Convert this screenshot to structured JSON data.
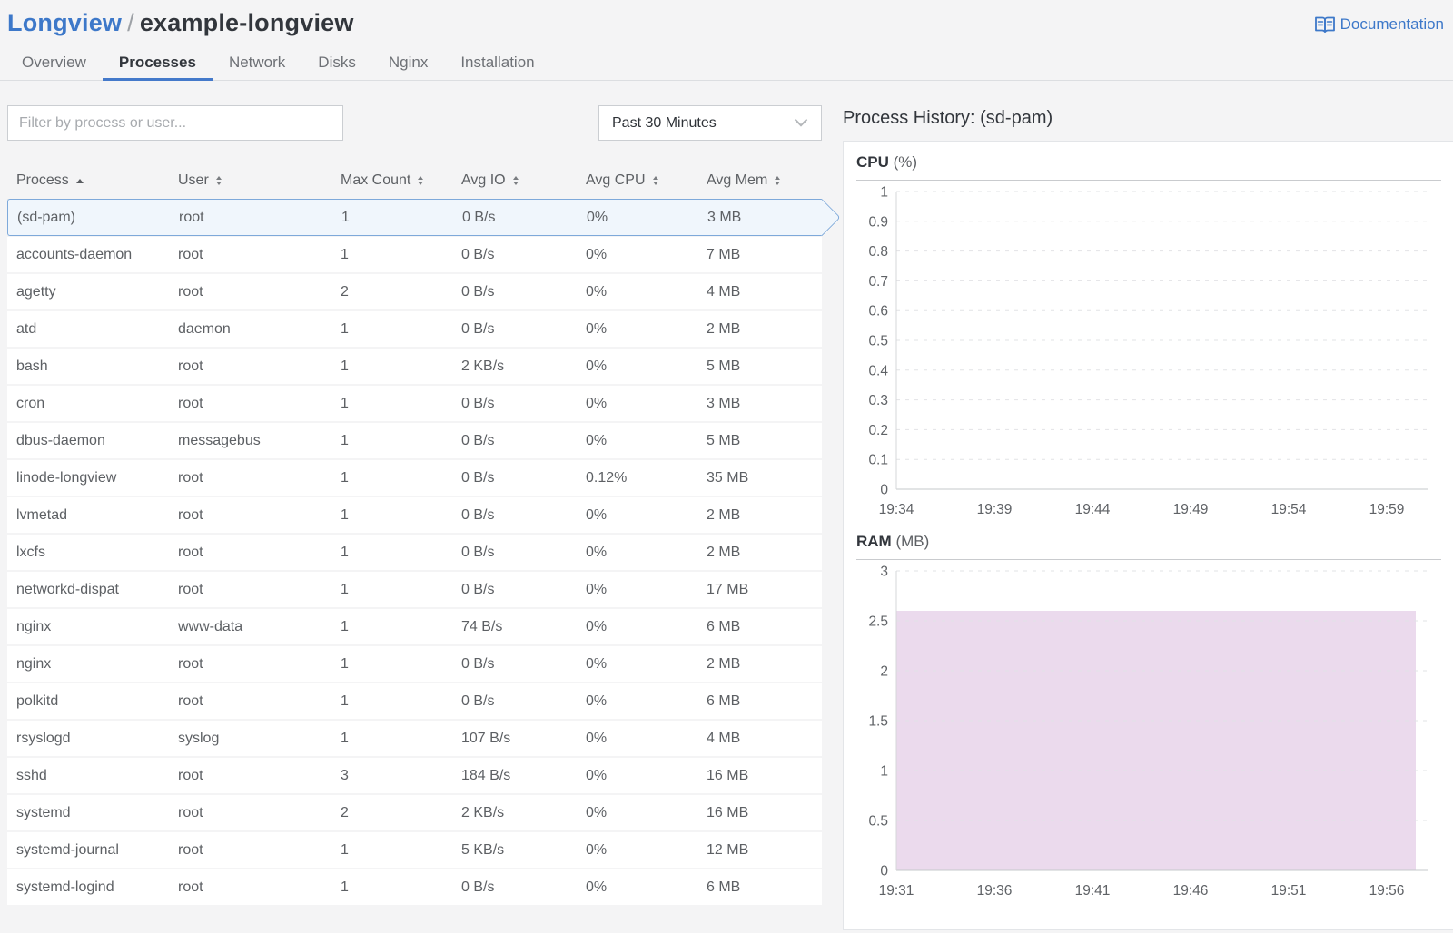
{
  "header": {
    "app": "Longview",
    "separator": "/",
    "instance": "example-longview",
    "doc_label": "Documentation"
  },
  "tabs": [
    {
      "label": "Overview",
      "active": false
    },
    {
      "label": "Processes",
      "active": true
    },
    {
      "label": "Network",
      "active": false
    },
    {
      "label": "Disks",
      "active": false
    },
    {
      "label": "Nginx",
      "active": false
    },
    {
      "label": "Installation",
      "active": false
    }
  ],
  "controls": {
    "filter_placeholder": "Filter by process or user...",
    "time_range": "Past 30 Minutes"
  },
  "table": {
    "columns": [
      {
        "label": "Process",
        "sort": "asc"
      },
      {
        "label": "User",
        "sort": "both"
      },
      {
        "label": "Max Count",
        "sort": "both"
      },
      {
        "label": "Avg IO",
        "sort": "both"
      },
      {
        "label": "Avg CPU",
        "sort": "both"
      },
      {
        "label": "Avg Mem",
        "sort": "both"
      }
    ],
    "rows": [
      {
        "process": "(sd-pam)",
        "user": "root",
        "max_count": "1",
        "avg_io": "0 B/s",
        "avg_cpu": "0%",
        "avg_mem": "3 MB",
        "selected": true
      },
      {
        "process": "accounts-daemon",
        "user": "root",
        "max_count": "1",
        "avg_io": "0 B/s",
        "avg_cpu": "0%",
        "avg_mem": "7 MB",
        "selected": false
      },
      {
        "process": "agetty",
        "user": "root",
        "max_count": "2",
        "avg_io": "0 B/s",
        "avg_cpu": "0%",
        "avg_mem": "4 MB",
        "selected": false
      },
      {
        "process": "atd",
        "user": "daemon",
        "max_count": "1",
        "avg_io": "0 B/s",
        "avg_cpu": "0%",
        "avg_mem": "2 MB",
        "selected": false
      },
      {
        "process": "bash",
        "user": "root",
        "max_count": "1",
        "avg_io": "2 KB/s",
        "avg_cpu": "0%",
        "avg_mem": "5 MB",
        "selected": false
      },
      {
        "process": "cron",
        "user": "root",
        "max_count": "1",
        "avg_io": "0 B/s",
        "avg_cpu": "0%",
        "avg_mem": "3 MB",
        "selected": false
      },
      {
        "process": "dbus-daemon",
        "user": "messagebus",
        "max_count": "1",
        "avg_io": "0 B/s",
        "avg_cpu": "0%",
        "avg_mem": "5 MB",
        "selected": false
      },
      {
        "process": "linode-longview",
        "user": "root",
        "max_count": "1",
        "avg_io": "0 B/s",
        "avg_cpu": "0.12%",
        "avg_mem": "35 MB",
        "selected": false
      },
      {
        "process": "lvmetad",
        "user": "root",
        "max_count": "1",
        "avg_io": "0 B/s",
        "avg_cpu": "0%",
        "avg_mem": "2 MB",
        "selected": false
      },
      {
        "process": "lxcfs",
        "user": "root",
        "max_count": "1",
        "avg_io": "0 B/s",
        "avg_cpu": "0%",
        "avg_mem": "2 MB",
        "selected": false
      },
      {
        "process": "networkd-dispat",
        "user": "root",
        "max_count": "1",
        "avg_io": "0 B/s",
        "avg_cpu": "0%",
        "avg_mem": "17 MB",
        "selected": false
      },
      {
        "process": "nginx",
        "user": "www-data",
        "max_count": "1",
        "avg_io": "74 B/s",
        "avg_cpu": "0%",
        "avg_mem": "6 MB",
        "selected": false
      },
      {
        "process": "nginx",
        "user": "root",
        "max_count": "1",
        "avg_io": "0 B/s",
        "avg_cpu": "0%",
        "avg_mem": "2 MB",
        "selected": false
      },
      {
        "process": "polkitd",
        "user": "root",
        "max_count": "1",
        "avg_io": "0 B/s",
        "avg_cpu": "0%",
        "avg_mem": "6 MB",
        "selected": false
      },
      {
        "process": "rsyslogd",
        "user": "syslog",
        "max_count": "1",
        "avg_io": "107 B/s",
        "avg_cpu": "0%",
        "avg_mem": "4 MB",
        "selected": false
      },
      {
        "process": "sshd",
        "user": "root",
        "max_count": "3",
        "avg_io": "184 B/s",
        "avg_cpu": "0%",
        "avg_mem": "16 MB",
        "selected": false
      },
      {
        "process": "systemd",
        "user": "root",
        "max_count": "2",
        "avg_io": "2 KB/s",
        "avg_cpu": "0%",
        "avg_mem": "16 MB",
        "selected": false
      },
      {
        "process": "systemd-journal",
        "user": "root",
        "max_count": "1",
        "avg_io": "5 KB/s",
        "avg_cpu": "0%",
        "avg_mem": "12 MB",
        "selected": false
      },
      {
        "process": "systemd-logind",
        "user": "root",
        "max_count": "1",
        "avg_io": "0 B/s",
        "avg_cpu": "0%",
        "avg_mem": "6 MB",
        "selected": false
      }
    ]
  },
  "history": {
    "title": "Process History: (sd-pam)"
  },
  "chart_data": [
    {
      "type": "area",
      "title": "CPU",
      "unit": "(%)",
      "ylim": [
        0,
        1
      ],
      "ytick_step": 0.1,
      "x_ticklabels": [
        "19:34",
        "19:39",
        "19:44",
        "19:49",
        "19:54",
        "19:59"
      ],
      "series": [
        {
          "name": "CPU %",
          "values": [
            0,
            0,
            0,
            0,
            0,
            0
          ]
        }
      ],
      "fill": "#ebdaed",
      "grid": "dashed-horizontal",
      "legend": "none"
    },
    {
      "type": "area",
      "title": "RAM",
      "unit": "(MB)",
      "ylim": [
        0,
        3
      ],
      "ytick_step": 0.5,
      "x_ticklabels": [
        "19:31",
        "19:36",
        "19:41",
        "19:46",
        "19:51",
        "19:56"
      ],
      "series": [
        {
          "name": "RAM MB",
          "values": [
            2.6,
            2.6,
            2.6,
            2.6,
            2.6,
            2.6
          ]
        }
      ],
      "fill": "#ebdaed",
      "grid": "dashed-horizontal",
      "legend": "none"
    }
  ],
  "colors": {
    "accent_blue": "#3d78c9",
    "selected_row_bg": "#f0f6fc",
    "selected_row_border": "#7ea9da",
    "ram_area_fill": "#ebdaed",
    "page_bg": "#f4f4f5",
    "grid_dash": "#e2e3e6"
  }
}
